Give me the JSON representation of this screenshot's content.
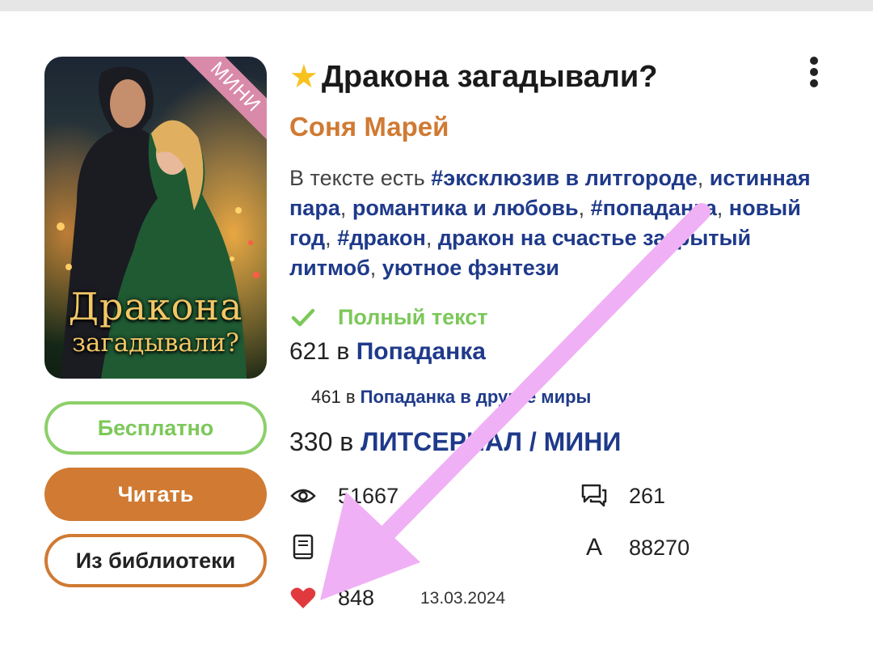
{
  "book": {
    "title": "Дракона загадывали?",
    "author": "Соня Марей",
    "cover": {
      "title_line1": "Дракона",
      "title_line2": "загадывали?",
      "ribbon": "МИНИ"
    },
    "tags_prefix": "В тексте есть",
    "tags": [
      "#эксклюзив в литгороде",
      "истинная пара",
      "романтика и любовь",
      "#попаданка",
      "новый год",
      "#дракон",
      "дракон на счастье закрытый литмоб",
      "уютное фэнтези"
    ],
    "status": "Полный текст",
    "rankings": [
      {
        "position": "621",
        "in": "в",
        "category": "Попаданка"
      },
      {
        "position": "461",
        "in": "в",
        "category": "Попаданка в другие миры"
      },
      {
        "position": "330",
        "in": "в",
        "category": "ЛИТСЕРИАЛ / МИНИ"
      }
    ],
    "stats": {
      "views": "51667",
      "comments": "261",
      "chars_letter": "A",
      "chars": "88270",
      "likes": "848",
      "date": "13.03.2024"
    }
  },
  "buttons": {
    "free": "Бесплатно",
    "read": "Читать",
    "library": "Из библиотеки"
  },
  "colors": {
    "accent": "#d07a33",
    "green": "#7cc85a",
    "link": "#1f3a8a",
    "heart": "#e03a3e",
    "annotation_arrow": "#f0b0f5"
  }
}
